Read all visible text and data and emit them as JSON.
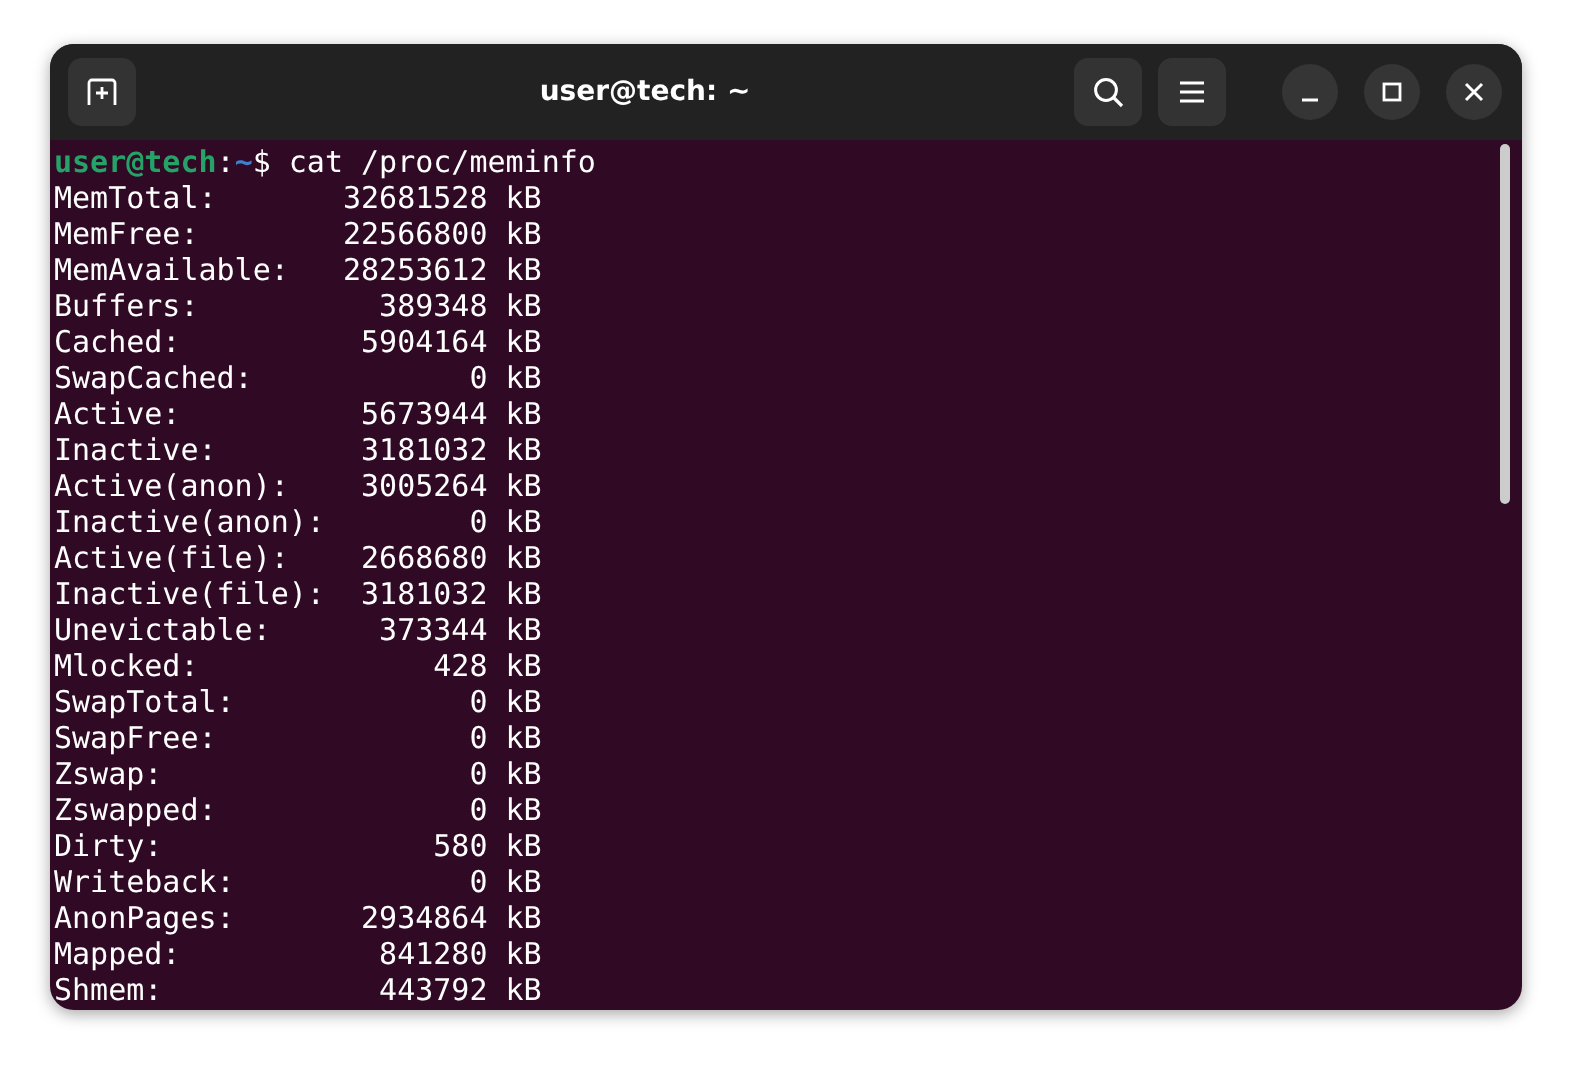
{
  "window": {
    "title": "user@tech: ~"
  },
  "terminal": {
    "prompt": {
      "user_host": "user@tech",
      "separator": ":",
      "path": "~",
      "symbol": "$",
      "command": "cat /proc/meminfo"
    },
    "lines": [
      "MemTotal:       32681528 kB",
      "MemFree:        22566800 kB",
      "MemAvailable:   28253612 kB",
      "Buffers:          389348 kB",
      "Cached:          5904164 kB",
      "SwapCached:            0 kB",
      "Active:          5673944 kB",
      "Inactive:        3181032 kB",
      "Active(anon):    3005264 kB",
      "Inactive(anon):        0 kB",
      "Active(file):    2668680 kB",
      "Inactive(file):  3181032 kB",
      "Unevictable:      373344 kB",
      "Mlocked:             428 kB",
      "SwapTotal:             0 kB",
      "SwapFree:              0 kB",
      "Zswap:                 0 kB",
      "Zswapped:              0 kB",
      "Dirty:               580 kB",
      "Writeback:             0 kB",
      "AnonPages:       2934864 kB",
      "Mapped:           841280 kB",
      "Shmem:            443792 kB"
    ]
  }
}
